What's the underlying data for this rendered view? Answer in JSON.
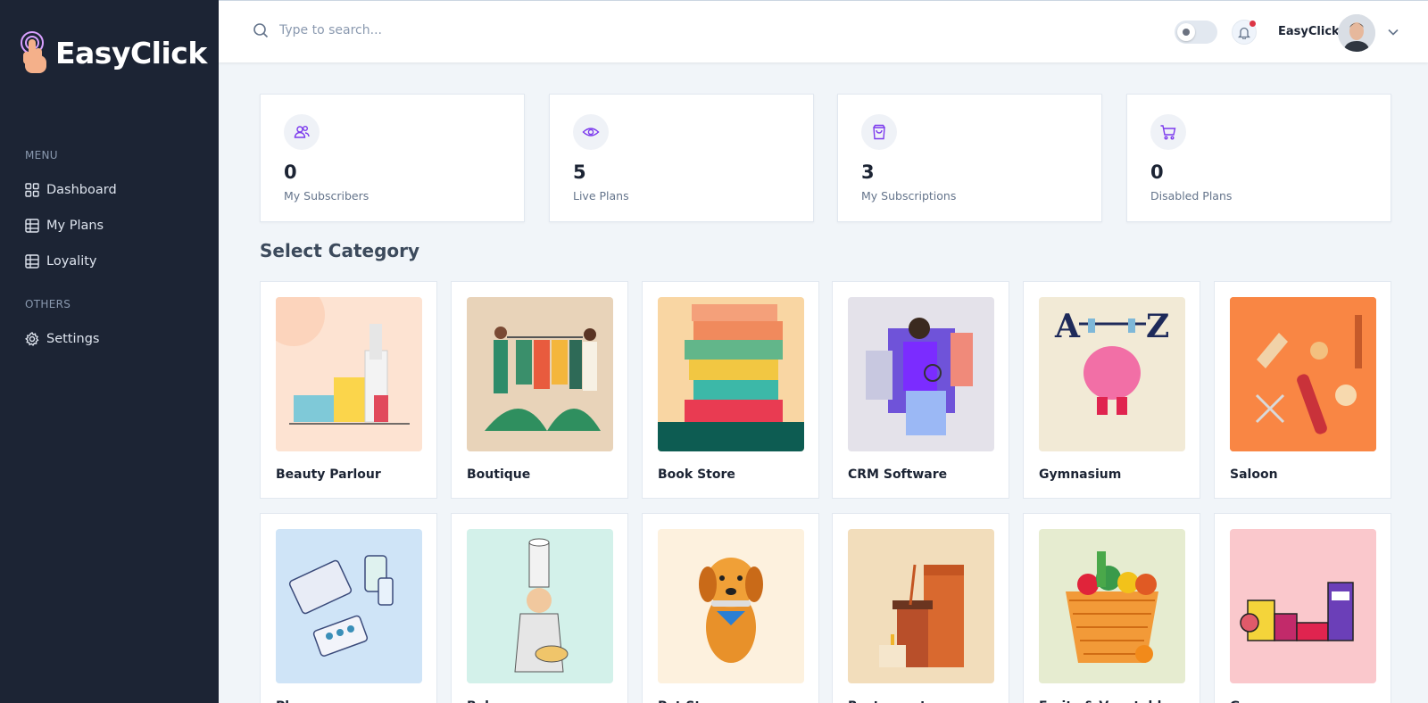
{
  "brand": {
    "name": "EasyClick"
  },
  "sidebar": {
    "menu_heading": "MENU",
    "items": [
      {
        "label": "Dashboard",
        "icon": "grid-icon"
      },
      {
        "label": "My Plans",
        "icon": "table-icon"
      },
      {
        "label": "Loyality",
        "icon": "table-icon"
      }
    ],
    "others_heading": "OTHERS",
    "others_items": [
      {
        "label": "Settings",
        "icon": "gear-icon"
      }
    ]
  },
  "header": {
    "search_placeholder": "Type to search...",
    "username": "EasyClick",
    "dark_mode": false,
    "has_notification": true
  },
  "stats": [
    {
      "value": "0",
      "label": "My Subscribers",
      "icon": "users-icon"
    },
    {
      "value": "5",
      "label": "Live Plans",
      "icon": "eye-icon"
    },
    {
      "value": "3",
      "label": "My Subscriptions",
      "icon": "bag-icon"
    },
    {
      "value": "0",
      "label": "Disabled Plans",
      "icon": "cart-icon"
    }
  ],
  "section_title": "Select Category",
  "categories": [
    {
      "name": "Beauty Parlour",
      "bg": "#fde3d2"
    },
    {
      "name": "Boutique",
      "bg": "#e8d3b9"
    },
    {
      "name": "Book Store",
      "bg": "#f9d6a3"
    },
    {
      "name": "CRM Software",
      "bg": "#e4e2ea"
    },
    {
      "name": "Gymnasium",
      "bg": "#f2ead6"
    },
    {
      "name": "Saloon",
      "bg": "#f98644"
    },
    {
      "name": "Pharmacy",
      "bg": "#cfe4f7"
    },
    {
      "name": "Bakery",
      "bg": "#d3f1ea"
    },
    {
      "name": "Pet Store",
      "bg": "#fdf1de"
    },
    {
      "name": "Restaurant",
      "bg": "#f2ddbb"
    },
    {
      "name": "Fruits & Vegetables",
      "bg": "#e6ecd0"
    },
    {
      "name": "Grocery",
      "bg": "#fac8cc"
    }
  ]
}
